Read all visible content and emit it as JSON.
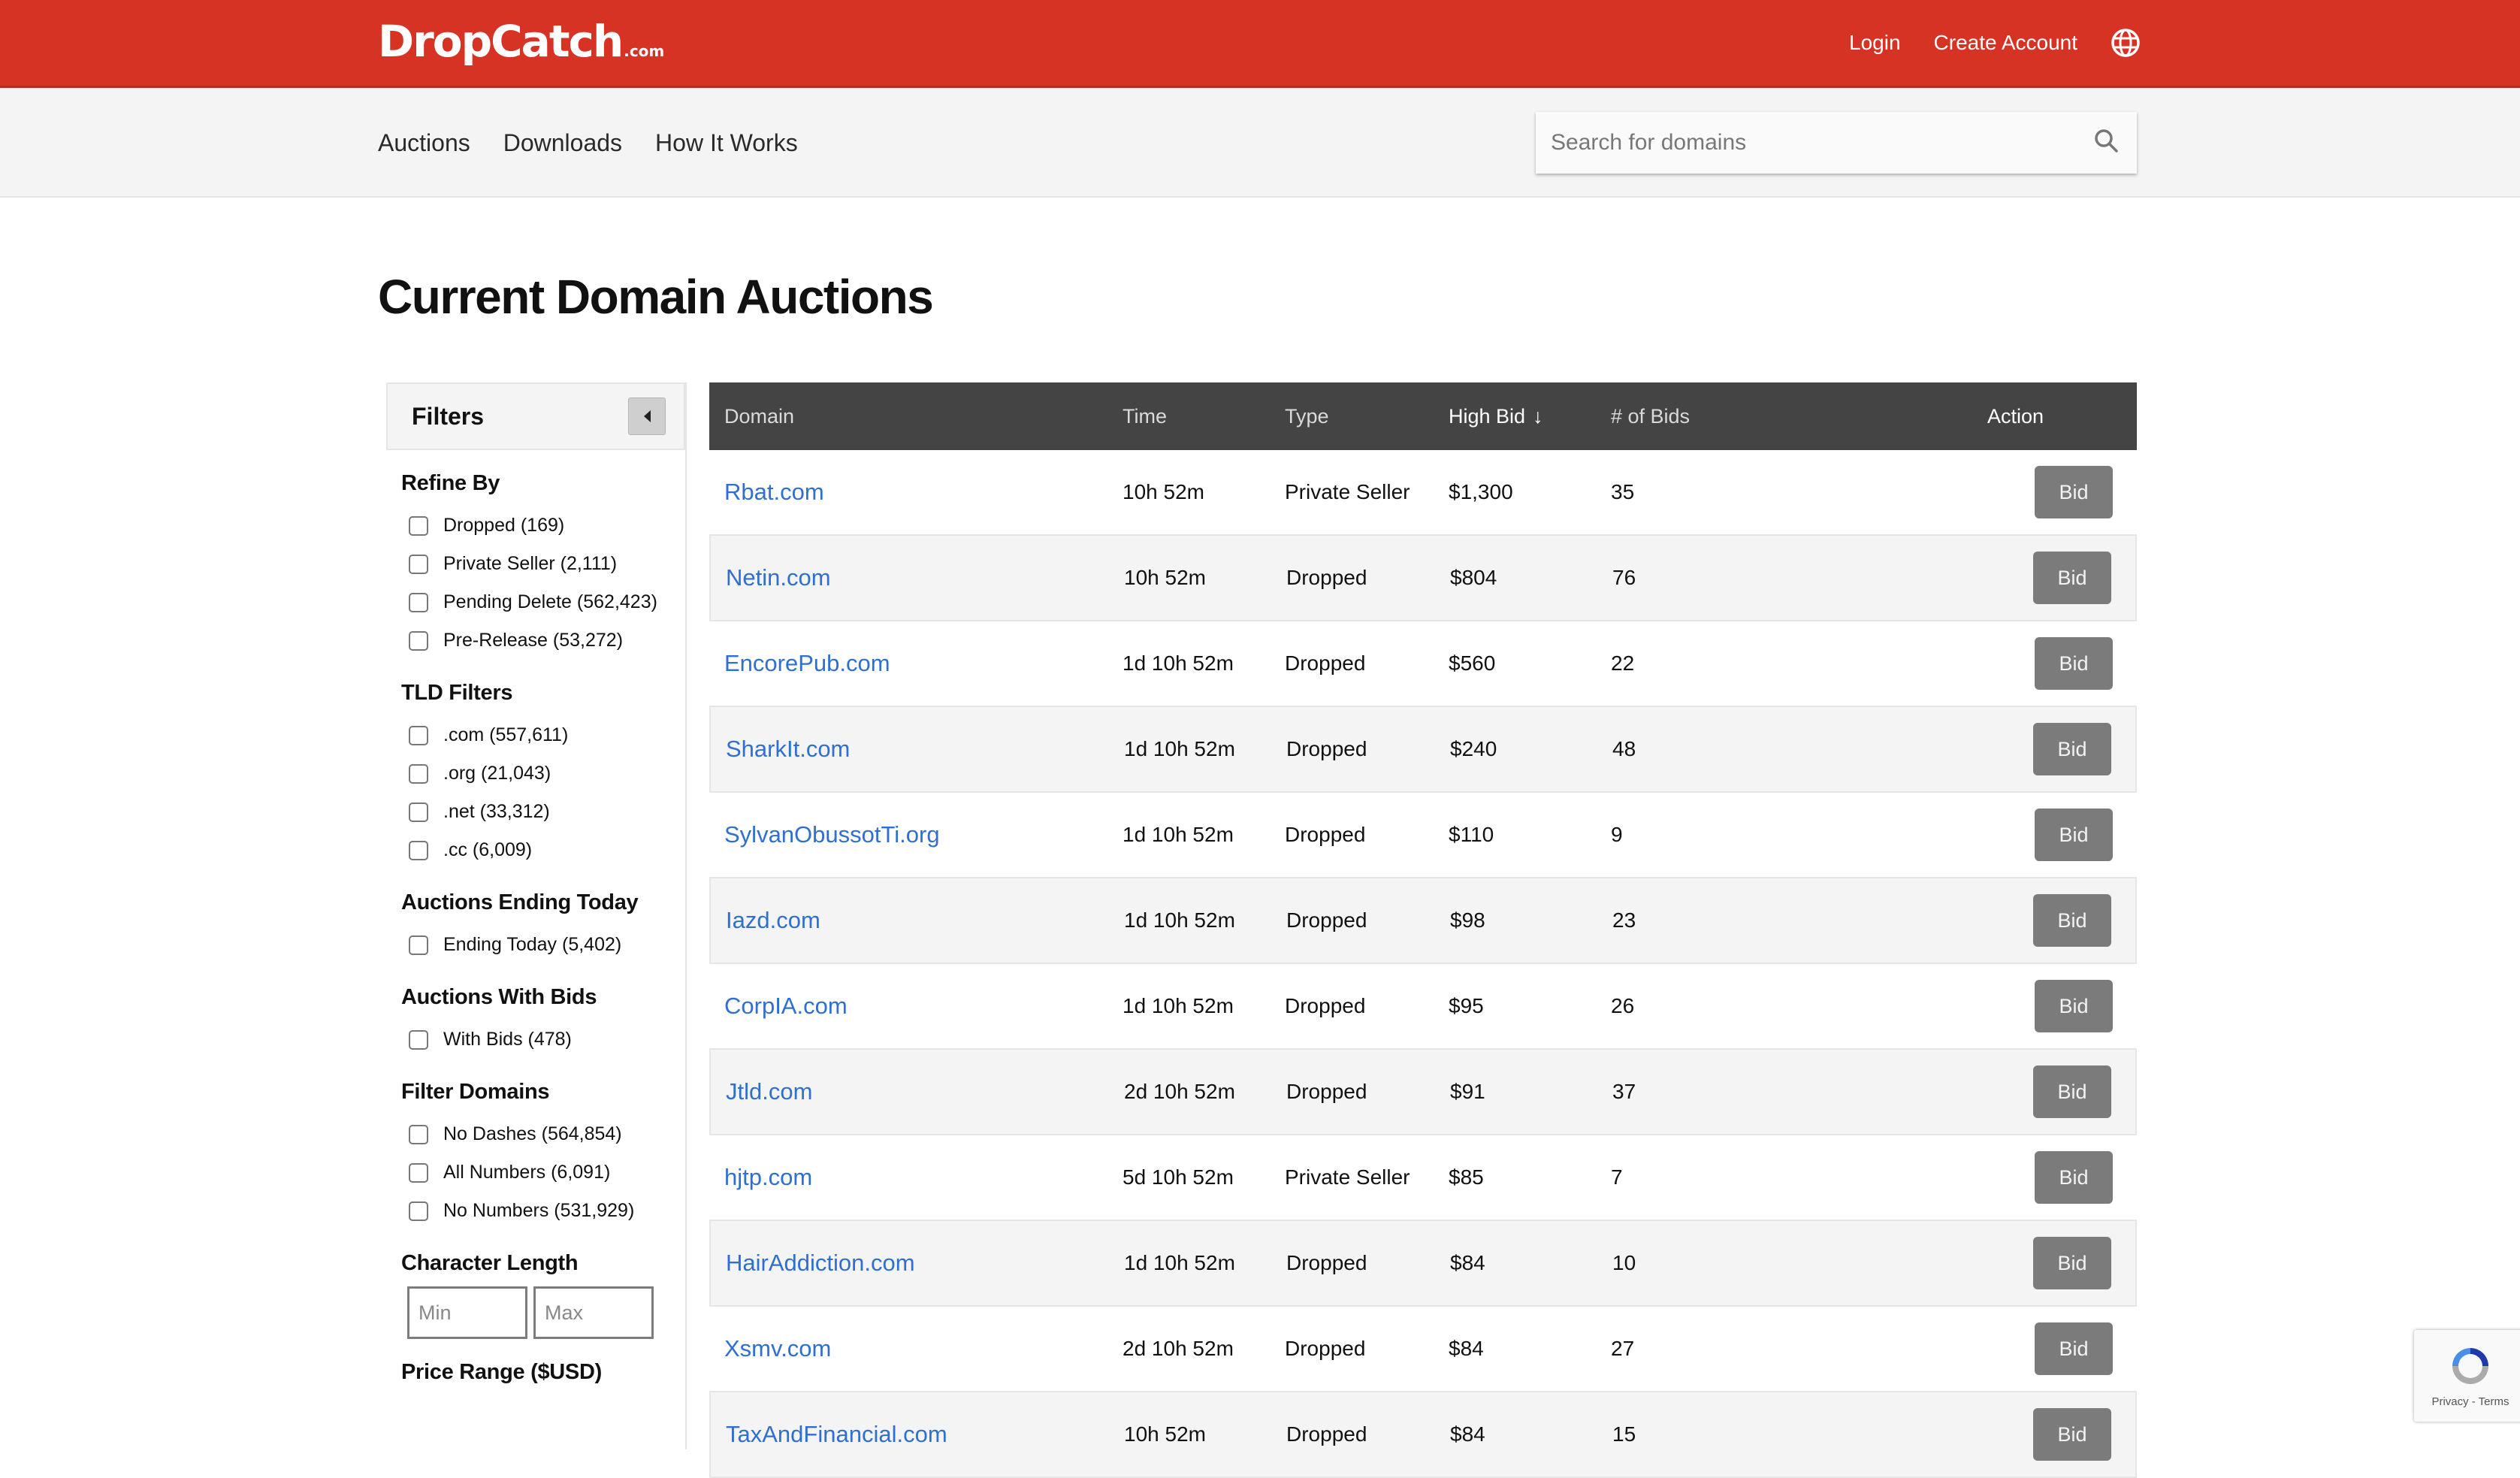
{
  "header": {
    "logo_main": "DropCatch",
    "logo_tld": ".com",
    "login": "Login",
    "create_account": "Create Account",
    "language_icon": "globe-icon",
    "brand_color": "#d63324"
  },
  "nav": {
    "items": [
      "Auctions",
      "Downloads",
      "How It Works"
    ],
    "search_placeholder": "Search for domains",
    "search_icon": "search-icon"
  },
  "page_title": "Current Domain Auctions",
  "filters": {
    "title": "Filters",
    "sections": [
      {
        "heading": "Refine By",
        "options": [
          "Dropped (169)",
          "Private Seller (2,111)",
          "Pending Delete (562,423)",
          "Pre-Release (53,272)"
        ]
      },
      {
        "heading": "TLD Filters",
        "options": [
          ".com (557,611)",
          ".org (21,043)",
          ".net (33,312)",
          ".cc (6,009)"
        ]
      },
      {
        "heading": "Auctions Ending Today",
        "options": [
          "Ending Today (5,402)"
        ]
      },
      {
        "heading": "Auctions With Bids",
        "options": [
          "With Bids (478)"
        ]
      },
      {
        "heading": "Filter Domains",
        "options": [
          "No Dashes (564,854)",
          "All Numbers (6,091)",
          "No Numbers (531,929)"
        ]
      }
    ],
    "char_length": {
      "heading": "Character Length",
      "min_placeholder": "Min",
      "max_placeholder": "Max"
    },
    "price_range_heading": "Price Range ($USD)"
  },
  "table": {
    "columns": {
      "domain": "Domain",
      "time": "Time",
      "type": "Type",
      "high_bid": "High Bid",
      "sort_arrow": "↓",
      "bids": "# of Bids",
      "action": "Action"
    },
    "bid_label": "Bid",
    "rows": [
      {
        "domain": "Rbat.com",
        "time": "10h 52m",
        "type": "Private Seller",
        "high_bid": "$1,300",
        "bids": "35"
      },
      {
        "domain": "Netin.com",
        "time": "10h 52m",
        "type": "Dropped",
        "high_bid": "$804",
        "bids": "76"
      },
      {
        "domain": "EncorePub.com",
        "time": "1d 10h 52m",
        "type": "Dropped",
        "high_bid": "$560",
        "bids": "22"
      },
      {
        "domain": "SharkIt.com",
        "time": "1d 10h 52m",
        "type": "Dropped",
        "high_bid": "$240",
        "bids": "48"
      },
      {
        "domain": "SylvanObussotTi.org",
        "time": "1d 10h 52m",
        "type": "Dropped",
        "high_bid": "$110",
        "bids": "9"
      },
      {
        "domain": "Iazd.com",
        "time": "1d 10h 52m",
        "type": "Dropped",
        "high_bid": "$98",
        "bids": "23"
      },
      {
        "domain": "CorpIA.com",
        "time": "1d 10h 52m",
        "type": "Dropped",
        "high_bid": "$95",
        "bids": "26"
      },
      {
        "domain": "Jtld.com",
        "time": "2d 10h 52m",
        "type": "Dropped",
        "high_bid": "$91",
        "bids": "37"
      },
      {
        "domain": "hjtp.com",
        "time": "5d 10h 52m",
        "type": "Private Seller",
        "high_bid": "$85",
        "bids": "7"
      },
      {
        "domain": "HairAddiction.com",
        "time": "1d 10h 52m",
        "type": "Dropped",
        "high_bid": "$84",
        "bids": "10"
      },
      {
        "domain": "Xsmv.com",
        "time": "2d 10h 52m",
        "type": "Dropped",
        "high_bid": "$84",
        "bids": "27"
      },
      {
        "domain": "TaxAndFinancial.com",
        "time": "10h 52m",
        "type": "Dropped",
        "high_bid": "$84",
        "bids": "15"
      }
    ]
  },
  "recaptcha": {
    "text": "Privacy - Terms"
  }
}
